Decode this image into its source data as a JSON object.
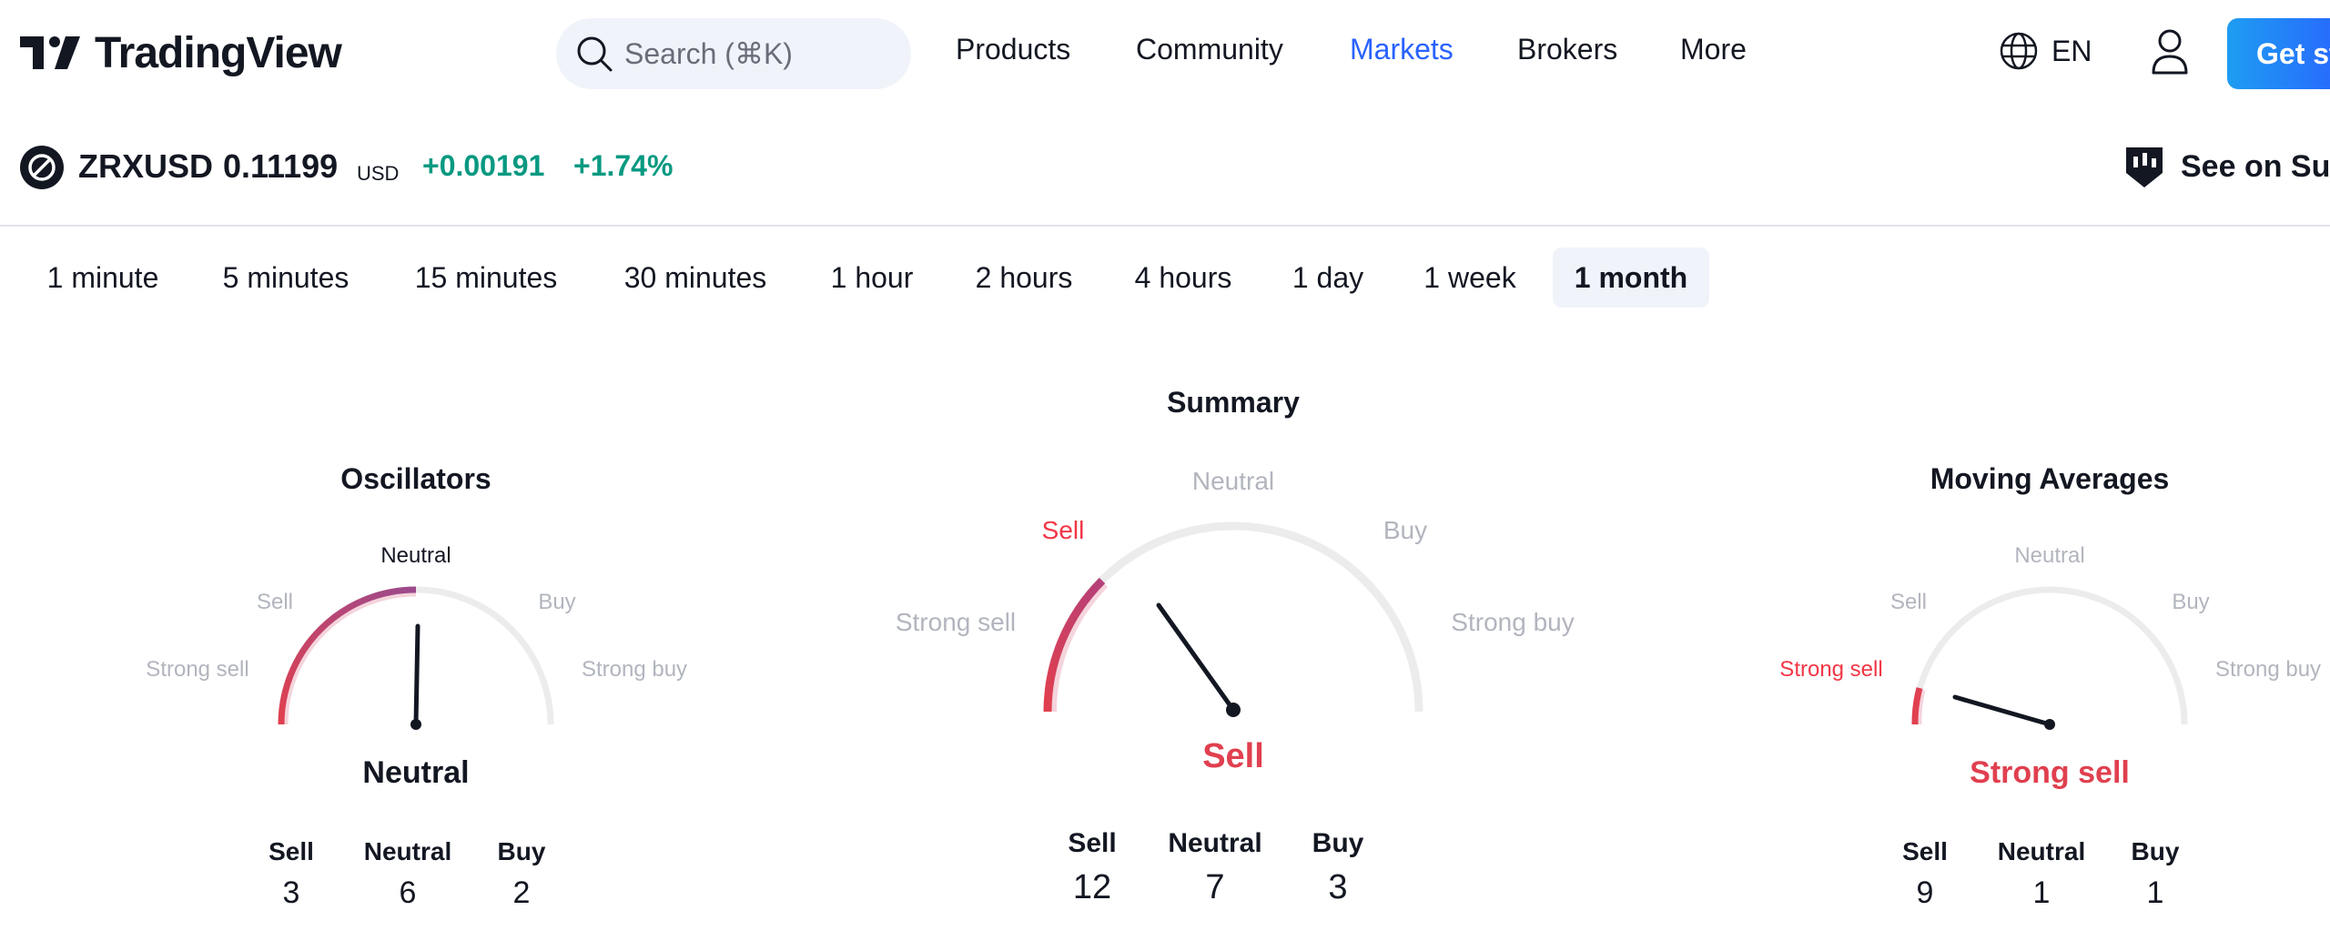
{
  "header": {
    "logo_text": "TradingView",
    "search_placeholder": "Search (⌘K)",
    "nav": [
      "Products",
      "Community",
      "Markets",
      "Brokers",
      "More"
    ],
    "active_nav": "Markets",
    "language": "EN",
    "cta_label": "Get st"
  },
  "symbol": {
    "name": "ZRXUSD",
    "price": "0.11199",
    "currency": "USD",
    "change": "+0.00191",
    "change_percent": "+1.74%",
    "superchart_label": "See on Sup"
  },
  "intervals": [
    "1 minute",
    "5 minutes",
    "15 minutes",
    "30 minutes",
    "1 hour",
    "2 hours",
    "4 hours",
    "1 day",
    "1 week",
    "1 month"
  ],
  "active_interval": "1 month",
  "gauges": {
    "oscillators": {
      "title": "Oscillators",
      "labels": {
        "strong_sell": "Strong sell",
        "sell": "Sell",
        "neutral": "Neutral",
        "buy": "Buy",
        "strong_buy": "Strong buy"
      },
      "result": "Neutral",
      "counts": {
        "sell_label": "Sell",
        "sell": "3",
        "neutral_label": "Neutral",
        "neutral": "6",
        "buy_label": "Buy",
        "buy": "2"
      }
    },
    "summary": {
      "title": "Summary",
      "labels": {
        "strong_sell": "Strong sell",
        "sell": "Sell",
        "neutral": "Neutral",
        "buy": "Buy",
        "strong_buy": "Strong buy"
      },
      "result": "Sell",
      "counts": {
        "sell_label": "Sell",
        "sell": "12",
        "neutral_label": "Neutral",
        "neutral": "7",
        "buy_label": "Buy",
        "buy": "3"
      }
    },
    "moving_averages": {
      "title": "Moving Averages",
      "labels": {
        "strong_sell": "Strong sell",
        "sell": "Sell",
        "neutral": "Neutral",
        "buy": "Buy",
        "strong_buy": "Strong buy"
      },
      "result": "Strong sell",
      "counts": {
        "sell_label": "Sell",
        "sell": "9",
        "neutral_label": "Neutral",
        "neutral": "1",
        "buy_label": "Buy",
        "buy": "1"
      }
    }
  },
  "colors": {
    "accent": "#2962ff",
    "positive": "#089981",
    "negative": "#f23645",
    "neutral_arc": "#9c4a8c",
    "track": "#ececec"
  }
}
